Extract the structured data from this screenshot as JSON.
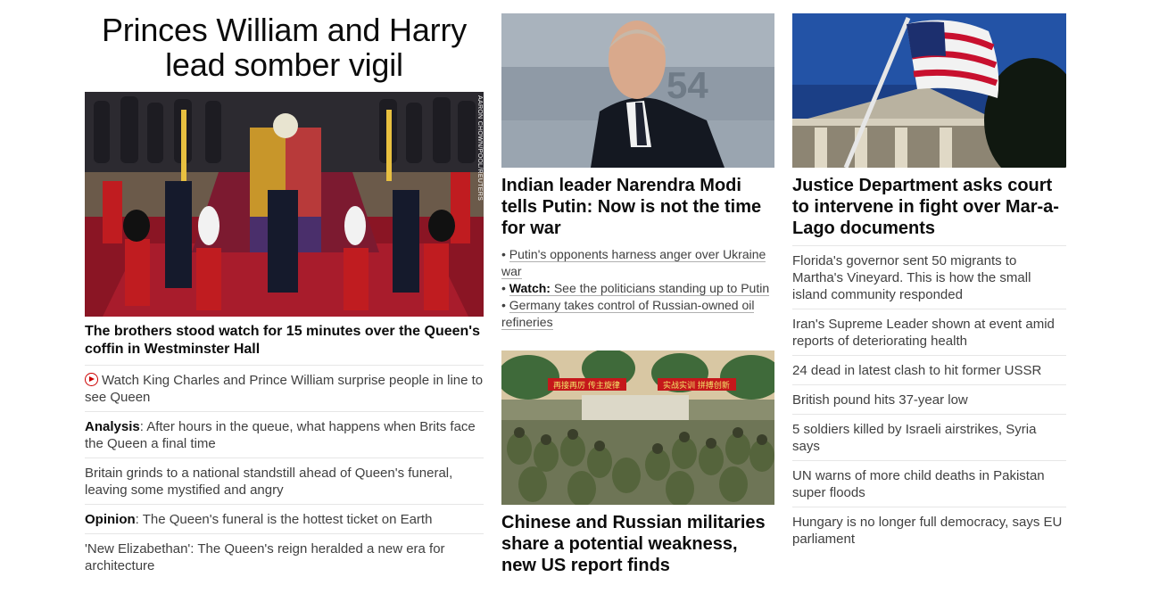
{
  "lead": {
    "title": "Princes William and Harry lead somber vigil",
    "image_credit": "AARON CHOWN/POOL/REUTERS",
    "subhead": "The brothers stood watch for 15 minutes over the Queen's coffin in Westminster Hall",
    "items": [
      {
        "prefix": "",
        "text": "Watch King Charles and Prince William surprise people in line to see Queen",
        "icon": "play-icon"
      },
      {
        "prefix": "Analysis",
        "text": ": After hours in the queue, what happens when Brits face the Queen a final time"
      },
      {
        "prefix": "",
        "text": "Britain grinds to a national standstill ahead of Queen's funeral, leaving some mystified and angry"
      },
      {
        "prefix": "Opinion",
        "text": ": The Queen's funeral is the hottest ticket on Earth"
      },
      {
        "prefix": "",
        "text": "'New Elizabethan': The Queen's reign heralded a new era for architecture"
      }
    ]
  },
  "middle": {
    "story1": {
      "headline": "Indian leader Narendra Modi tells Putin: Now is not the time for war",
      "bullets": [
        {
          "prefix": "",
          "text": "Putin's opponents harness anger over Ukraine war"
        },
        {
          "prefix": "Watch:",
          "text": " See the politicians standing up to Putin"
        },
        {
          "prefix": "",
          "text": "Germany takes control of Russian-owned oil refineries"
        }
      ]
    },
    "story2": {
      "headline": "Chinese and Russian militaries share a potential weakness, new US report finds",
      "banner_left": "再接再厉 传主旋律",
      "banner_right": "实战实训 拼搏创新"
    }
  },
  "right": {
    "headline": "Justice Department asks court to intervene in fight over Mar-a-Lago documents",
    "items": [
      "Florida's governor sent 50 migrants to Martha's Vineyard. This is how the small island community responded",
      "Iran's Supreme Leader shown at event amid reports of deteriorating health",
      "24 dead in latest clash to hit former USSR",
      "British pound hits 37-year low",
      "5 soldiers killed by Israeli airstrikes, Syria says",
      "UN warns of more child deaths in Pakistan super floods",
      "Hungary is no longer full democracy, says EU parliament"
    ]
  },
  "colors": {
    "text": "#0c0c0c",
    "secondary": "#404040",
    "divider": "#e6e6e6",
    "accent": "#cc0000"
  }
}
